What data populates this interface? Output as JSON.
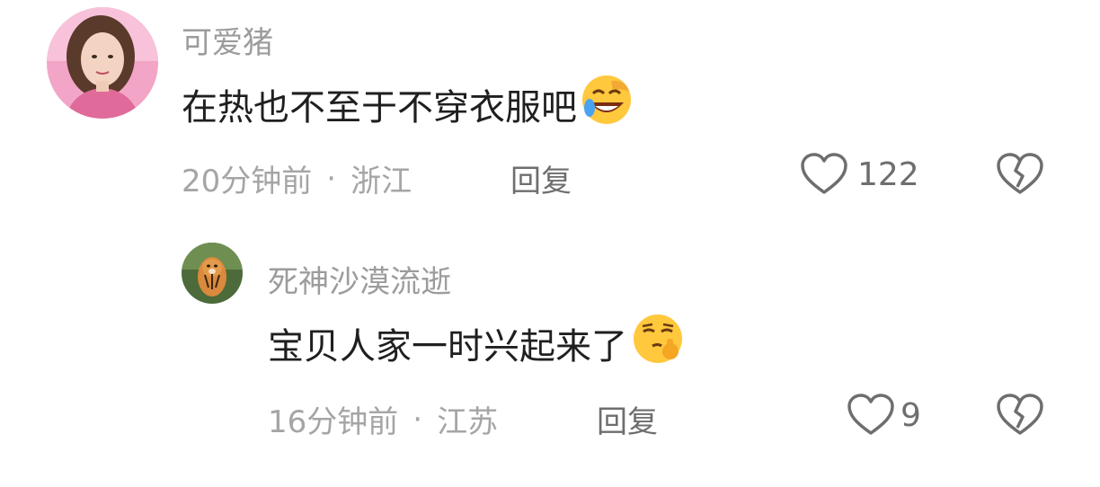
{
  "comments": [
    {
      "username": "可爱猪",
      "text": "在热也不至于不穿衣服吧",
      "emoji": "rolling-laughing-emoji",
      "time": "20分钟前",
      "separator": "·",
      "location": "浙江",
      "reply_label": "回复",
      "like_count": "122"
    },
    {
      "username": "死神沙漠流逝",
      "text": "宝贝人家一时兴起来了",
      "emoji": "shushing-smirk-emoji",
      "time": "16分钟前",
      "separator": "·",
      "location": "江苏",
      "reply_label": "回复",
      "like_count": "9"
    }
  ],
  "colors": {
    "username": "#9c9c9c",
    "text": "#1f1f1f",
    "meta": "#a5a5a5",
    "action": "#6e6e6e",
    "emoji_yellow": "#ffc83d"
  }
}
